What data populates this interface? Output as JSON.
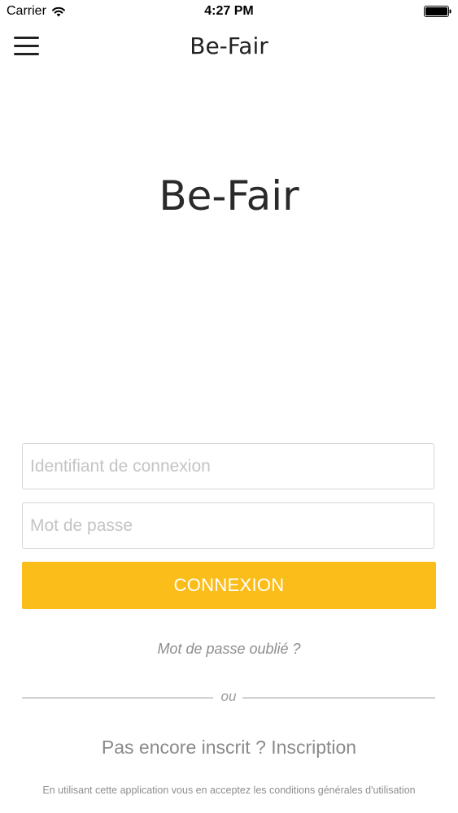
{
  "status_bar": {
    "carrier": "Carrier",
    "time": "4:27 PM",
    "icons": [
      "wifi-icon",
      "battery-icon"
    ]
  },
  "nav": {
    "title": "Be-Fair",
    "menu_icon": "hamburger-menu-icon"
  },
  "brand": {
    "title": "Be-Fair"
  },
  "login_form": {
    "login_placeholder": "Identifiant de connexion",
    "password_placeholder": "Mot de passe",
    "submit_label": "CONNEXION",
    "forgot_password": "Mot de passe oublié ?",
    "separator": "ou",
    "signup_prompt": "Pas encore inscrit ?",
    "signup_link": "Inscription",
    "terms": "En utilisant cette application vous en acceptez les conditions générales d'utilisation"
  },
  "colors": {
    "accent": "#fbbd19",
    "text_dark": "#2a2a2a",
    "text_muted": "#8e8e8e",
    "field_border": "#d6d6d6",
    "placeholder": "#c4c4c4"
  }
}
